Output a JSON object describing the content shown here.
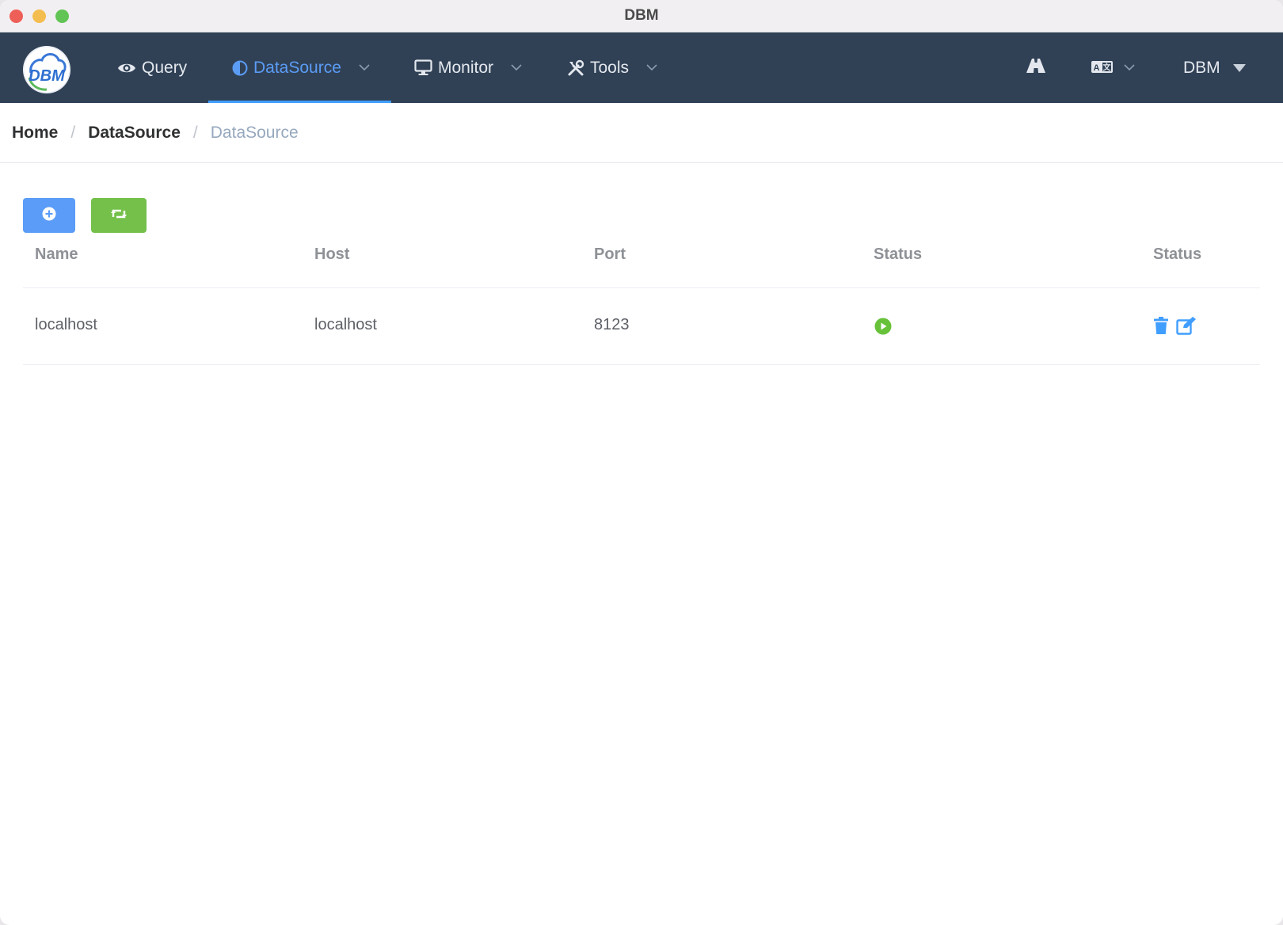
{
  "window": {
    "title": "DBM"
  },
  "nav": {
    "items": [
      {
        "label": "Query",
        "icon": "eye-icon"
      },
      {
        "label": "DataSource",
        "icon": "half-circle-icon",
        "active": true,
        "has_dropdown": true
      },
      {
        "label": "Monitor",
        "icon": "monitor-icon",
        "has_dropdown": true
      },
      {
        "label": "Tools",
        "icon": "tools-icon",
        "has_dropdown": true
      }
    ],
    "right": {
      "road_icon": "road-icon",
      "language_icon": "translate-icon",
      "user_label": "DBM"
    },
    "accent_color": "#409eff",
    "bg_color": "#304156"
  },
  "logo": {
    "text": "DBM"
  },
  "breadcrumb": {
    "items": [
      "Home",
      "DataSource",
      "DataSource"
    ],
    "separator": "/"
  },
  "toolbar": {
    "add_icon": "plus-circle-icon",
    "refresh_icon": "retweet-icon",
    "add_color": "#5a9cf8",
    "refresh_color": "#74c04b"
  },
  "table": {
    "columns": [
      "Name",
      "Host",
      "Port",
      "Status",
      "Status"
    ],
    "rows": [
      {
        "name": "localhost",
        "host": "localhost",
        "port": "8123",
        "status_icon": "play-circle-icon",
        "actions": [
          "trash-icon",
          "edit-icon"
        ]
      }
    ]
  }
}
